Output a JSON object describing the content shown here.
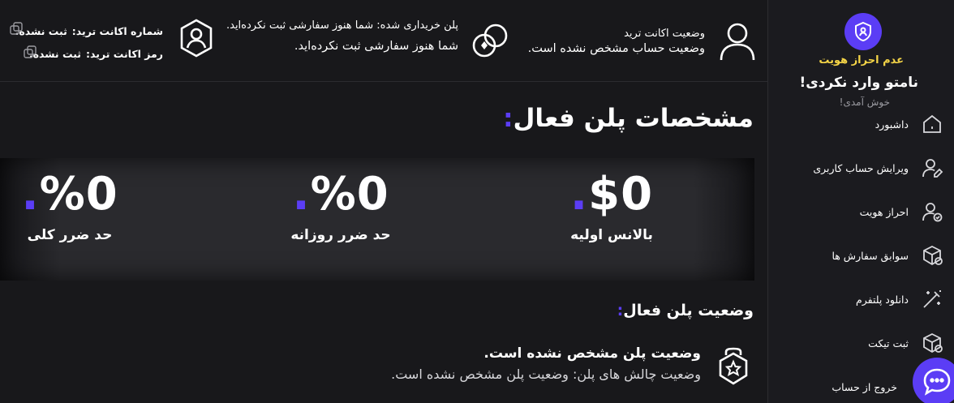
{
  "sidebar": {
    "kyc_status": "عدم احراز هویت",
    "greeting_title": "نامتو وارد نکردی!",
    "greeting_sub": "خوش آمدی!",
    "items": [
      {
        "label": "داشبورد",
        "icon": "home-icon"
      },
      {
        "label": "ویرایش حساب کاربری",
        "icon": "user-edit-icon"
      },
      {
        "label": "احراز هویت",
        "icon": "user-check-icon"
      },
      {
        "label": "سوابق سفارش ها",
        "icon": "box-icon"
      },
      {
        "label": "دانلود پلتفرم",
        "icon": "wand-icon"
      },
      {
        "label": "ثبت تیکت",
        "icon": "box-ticket-icon"
      },
      {
        "label": "خروج از حساب",
        "icon": "logout-icon"
      }
    ]
  },
  "topbar": {
    "account_status_title": "وضعیت اکانت ترید",
    "account_status_value": "وضعیت حساب مشخص نشده است.",
    "plan_purchased_line": "پلن خریداری شده: شما هنوز سفارشی ثبت نکرده‌اید.",
    "plan_purchased_sub": "شما هنوز سفارشی ثبت نکرده‌اید.",
    "account_number_label": "شماره اکانت ترید:",
    "account_number_value": "ثبت نشده.",
    "account_password_label": "رمز اکانت ترید:",
    "account_password_value": "ثبت نشده."
  },
  "main": {
    "title": "مشخصات پلن فعال",
    "title_dot": ":",
    "stats": [
      {
        "value": "$0",
        "label": "بالانس اولیه"
      },
      {
        "value": "%0",
        "label": "حد ضرر روزانه"
      },
      {
        "value": "%0",
        "label": "حد ضرر کلی"
      }
    ],
    "stat_dot": ".",
    "section_title": "وضعیت پلن فعال",
    "section_dot": ":",
    "plan_status_line1": "وضعیت پلن مشخص نشده است.",
    "plan_status_line2": "وضعیت چالش های پلن: وضعیت پلن مشخص نشده است."
  },
  "colors": {
    "accent": "#5b3df5",
    "warning": "#f5d547",
    "background": "#18181b"
  }
}
